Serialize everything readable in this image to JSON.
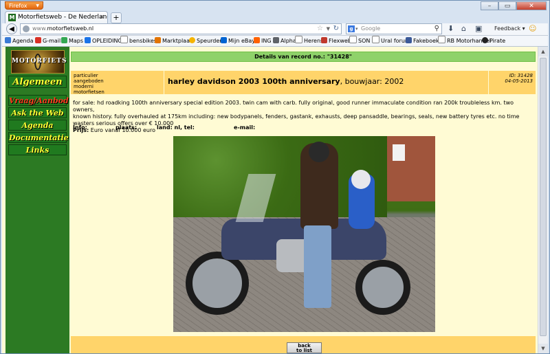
{
  "browser": {
    "app_button": "Firefox",
    "tab_title": "Motorfietsweb - De Nederlandse site ove...",
    "url_prefix": "www.",
    "url_domain": "motorfietsweb.nl",
    "search_engine": "Google",
    "search_placeholder": "Google",
    "feedback_label": "Feedback"
  },
  "bookmarks": [
    {
      "label": "Agenda",
      "color": "#3a7bd5"
    },
    {
      "label": "G-mail",
      "color": "#d93025"
    },
    {
      "label": "Maps",
      "color": "#34a853"
    },
    {
      "label": "OPLEIDING",
      "color": "#1a73e8"
    },
    {
      "label": "bensbikes",
      "color": "#888888"
    },
    {
      "label": "Marktplaats",
      "color": "#e37400"
    },
    {
      "label": "Speurders",
      "color": "#f5b400"
    },
    {
      "label": "Mijn eBay",
      "color": "#0064d2"
    },
    {
      "label": "ING",
      "color": "#ff6200"
    },
    {
      "label": "Alpha",
      "color": "#5f6368"
    },
    {
      "label": "Herens",
      "color": "#777777"
    },
    {
      "label": "Flexweb",
      "color": "#c0392b"
    },
    {
      "label": "SON",
      "color": "#999999"
    },
    {
      "label": "Ural forum",
      "color": "#999999"
    },
    {
      "label": "Fakeboek",
      "color": "#3b5998"
    },
    {
      "label": "RB Motorhandel",
      "color": "#999999"
    },
    {
      "label": "Pirate",
      "color": "#222222"
    }
  ],
  "sidebar": {
    "logo_text": "MOTORFIETS",
    "items": [
      {
        "label": "Algemeen"
      },
      {
        "label": "Vraag/Aanbod"
      },
      {
        "label": "Ask the Web"
      },
      {
        "label": "Agenda"
      },
      {
        "label": "Documentatie"
      },
      {
        "label": "Links"
      }
    ]
  },
  "record": {
    "title_bar": "Details van record no.: \"31428\"",
    "categories": [
      "particulier",
      "aangeboden",
      "moderni",
      "motorfietsen"
    ],
    "title": "harley davidson 2003 100th anniversary",
    "year_text": ", bouwjaar: 2002",
    "id_text": "ID: 31428",
    "date_text": "04-05-2013",
    "description_lines": [
      "for sale: hd roadking 100th anniversary special edition 2003. twin cam with carb. fully original, good runner immaculate condition ran 200k troubleless km. two owners,",
      "known history. fully overhauled at 175km including: new bodypanels, fenders, gastank, exhausts, deep pansaddle, bearings, seals, new battery tyres etc. no time",
      "wasters serious offers over € 10.000"
    ],
    "price_label": "Prijs:",
    "price_value": " Euro vanaf 10.000 euro",
    "info_label": "Info:",
    "plaats_label": "plaats:",
    "land_label": "land: nl, tel:",
    "email_label": "e-mail:",
    "back_line1": "back",
    "back_line2": "to list"
  }
}
